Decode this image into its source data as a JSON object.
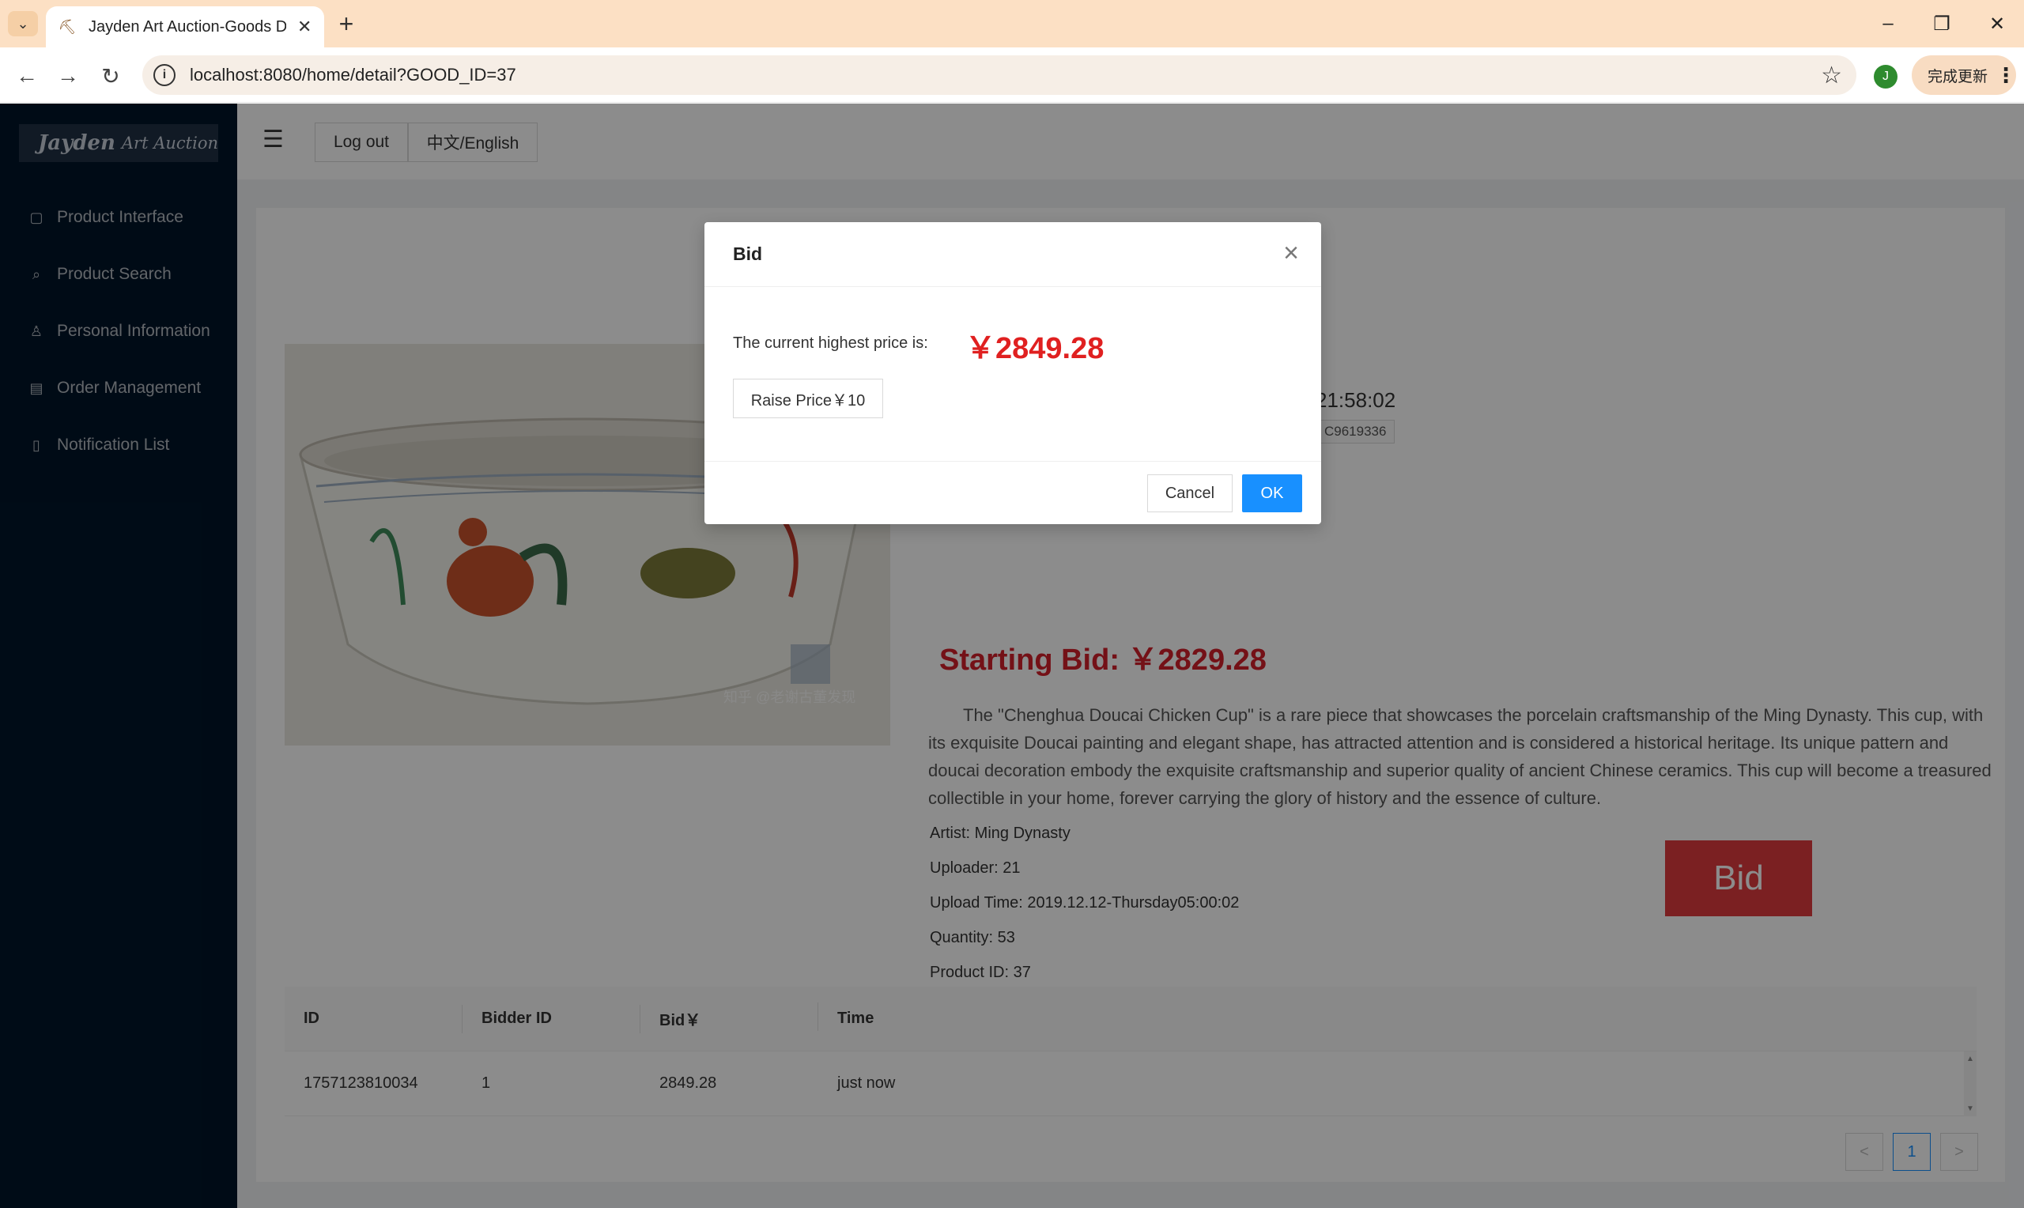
{
  "browser": {
    "tab_title": "Jayden Art Auction-Goods D",
    "url": "localhost:8080/home/detail?GOOD_ID=37",
    "profile_initial": "J",
    "update_label": "完成更新"
  },
  "sidebar": {
    "logo_main": "Jayden",
    "logo_sub": "Art Auction",
    "items": [
      {
        "label": "Product Interface",
        "icon": "shopping-bag-icon"
      },
      {
        "label": "Product Search",
        "icon": "search-doc-icon"
      },
      {
        "label": "Personal Information",
        "icon": "user-icon"
      },
      {
        "label": "Order Management",
        "icon": "order-doc-icon"
      },
      {
        "label": "Notification List",
        "icon": "file-icon"
      }
    ]
  },
  "header": {
    "logout_label": "Log out",
    "lang_label": "中文/English"
  },
  "product": {
    "timer_fragment": "21:58:02",
    "tag_fragment": "C9619336",
    "starting_bid": "Starting Bid: ￥2829.28",
    "description": "The \"Chenghua Doucai Chicken Cup\" is a rare piece that showcases the porcelain craftsmanship of the Ming Dynasty. This cup, with its exquisite Doucai painting and elegant shape, has attracted attention and is considered a historical heritage. Its unique pattern and doucai decoration embody the exquisite craftsmanship and superior quality of ancient Chinese ceramics. This cup will become a treasured collectible in your home, forever carrying the glory of history and the essence of culture.",
    "artist": "Artist: Ming Dynasty",
    "uploader": "Uploader: 21",
    "upload_time": "Upload Time: 2019.12.12-Thursday05:00:02",
    "quantity": "Quantity: 53",
    "product_id": "Product ID: 37",
    "bid_button": "Bid",
    "image_watermark": "知乎 @老谢古董发现"
  },
  "bids_table": {
    "headers": [
      "ID",
      "Bidder ID",
      "Bid￥",
      "Time"
    ],
    "rows": [
      [
        "1757123810034",
        "1",
        "2849.28",
        "just now"
      ]
    ]
  },
  "pagination": {
    "prev": "<",
    "current": "1",
    "next": ">"
  },
  "modal": {
    "title": "Bid",
    "price_label": "The current highest price is:",
    "price_value": "￥2849.28",
    "raise_label": "Raise Price￥10",
    "cancel_label": "Cancel",
    "ok_label": "OK"
  },
  "colors": {
    "sidebar_bg": "#001529",
    "accent_blue": "#1890ff",
    "price_red": "#e02020",
    "bid_button_red": "#e13b3e"
  }
}
